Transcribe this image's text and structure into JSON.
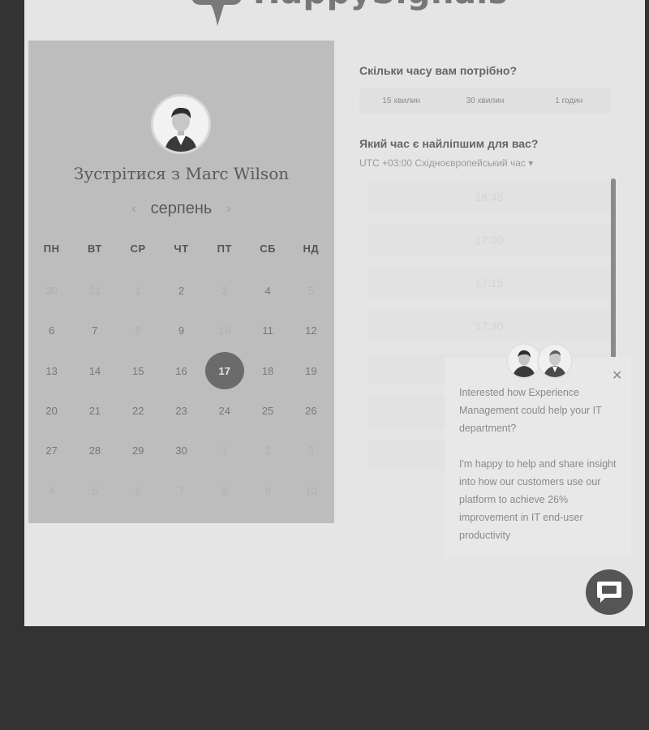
{
  "brand": {
    "name": "HappySignals"
  },
  "host": {
    "meet_title": "Зустрітися з Marc Wilson"
  },
  "calendar": {
    "month": "серпень",
    "weekdays": [
      "ПН",
      "ВТ",
      "СР",
      "ЧТ",
      "ПТ",
      "СБ",
      "НД"
    ],
    "days": [
      {
        "label": "30",
        "muted": true
      },
      {
        "label": "31",
        "muted": true
      },
      {
        "label": "1",
        "muted": true
      },
      {
        "label": "2",
        "muted": false
      },
      {
        "label": "3",
        "muted": true
      },
      {
        "label": "4",
        "muted": false
      },
      {
        "label": "5",
        "muted": true
      },
      {
        "label": "6",
        "muted": false
      },
      {
        "label": "7",
        "muted": false
      },
      {
        "label": "8",
        "muted": true
      },
      {
        "label": "9",
        "muted": false
      },
      {
        "label": "10",
        "muted": true
      },
      {
        "label": "11",
        "muted": false
      },
      {
        "label": "12",
        "muted": false
      },
      {
        "label": "13",
        "muted": false
      },
      {
        "label": "14",
        "muted": false
      },
      {
        "label": "15",
        "muted": false
      },
      {
        "label": "16",
        "muted": false
      },
      {
        "label": "17",
        "muted": false,
        "selected": true
      },
      {
        "label": "18",
        "muted": false
      },
      {
        "label": "19",
        "muted": false
      },
      {
        "label": "20",
        "muted": false
      },
      {
        "label": "21",
        "muted": false
      },
      {
        "label": "22",
        "muted": false
      },
      {
        "label": "23",
        "muted": false
      },
      {
        "label": "24",
        "muted": false
      },
      {
        "label": "25",
        "muted": false
      },
      {
        "label": "26",
        "muted": false
      },
      {
        "label": "27",
        "muted": false
      },
      {
        "label": "28",
        "muted": false
      },
      {
        "label": "29",
        "muted": false
      },
      {
        "label": "30",
        "muted": false
      },
      {
        "label": "1",
        "muted": true
      },
      {
        "label": "2",
        "muted": true
      },
      {
        "label": "3",
        "muted": true
      },
      {
        "label": "4",
        "muted": true
      },
      {
        "label": "5",
        "muted": true
      },
      {
        "label": "6",
        "muted": true
      },
      {
        "label": "7",
        "muted": true
      },
      {
        "label": "8",
        "muted": true
      },
      {
        "label": "9",
        "muted": true
      },
      {
        "label": "10",
        "muted": true
      }
    ]
  },
  "duration": {
    "question": "Скільки часу вам потрібно?",
    "options": [
      "15 хвилин",
      "30 хвилин",
      "1 годин"
    ]
  },
  "timeslots": {
    "question": "Який час є найліпшим для вас?",
    "timezone": "UTC +03:00 Східноєвропейський час ▾",
    "times": [
      "16:45",
      "17:00",
      "17:15",
      "17:30"
    ]
  },
  "popup": {
    "paragraph1": "Interested how Experience Management could help your IT department?",
    "paragraph2": "I'm happy to help and share insight into how our customers use our platform to achieve 26% improvement in IT end-user productivity"
  },
  "colors": {
    "background": "#333333",
    "panel": "#e5e5e5",
    "calendar_panel": "#bdbdbd",
    "selected_day": "#6b6b6b"
  },
  "icons": [
    "speech-bubble-logo-icon",
    "chevron-left-icon",
    "chevron-right-icon",
    "close-icon",
    "chat-icon"
  ]
}
